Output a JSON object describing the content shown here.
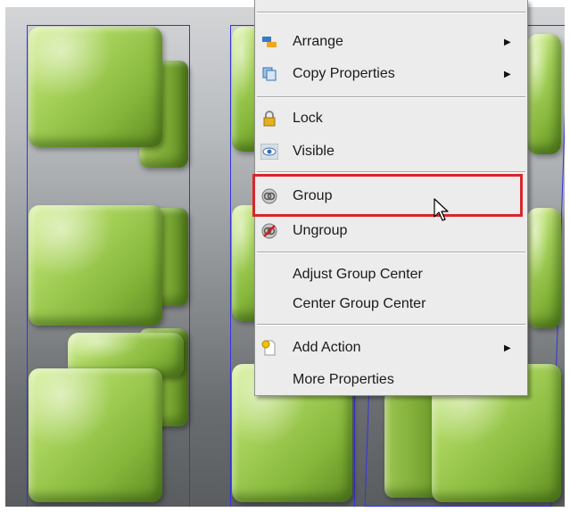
{
  "context_menu": {
    "items": [
      {
        "label": "Arrange",
        "icon": "arrange-icon",
        "submenu": true
      },
      {
        "label": "Copy Properties",
        "icon": "copy-properties-icon",
        "submenu": true
      },
      {
        "label": "Lock",
        "icon": "lock-icon",
        "submenu": false
      },
      {
        "label": "Visible",
        "icon": "eye-icon",
        "submenu": false
      },
      {
        "label": "Group",
        "icon": "group-icon",
        "submenu": false,
        "highlighted": true
      },
      {
        "label": "Ungroup",
        "icon": "ungroup-icon",
        "submenu": false
      },
      {
        "label": "Adjust Group Center",
        "icon": "",
        "submenu": false
      },
      {
        "label": "Center Group Center",
        "icon": "",
        "submenu": false
      },
      {
        "label": "Add Action",
        "icon": "add-action-icon",
        "submenu": true
      },
      {
        "label": "More Properties",
        "icon": "",
        "submenu": false
      }
    ],
    "submenu_arrow": "▶"
  },
  "colors": {
    "highlight_border": "#d9262c",
    "selection_box": "#3434e0",
    "cube_green": "#a7d25b"
  }
}
